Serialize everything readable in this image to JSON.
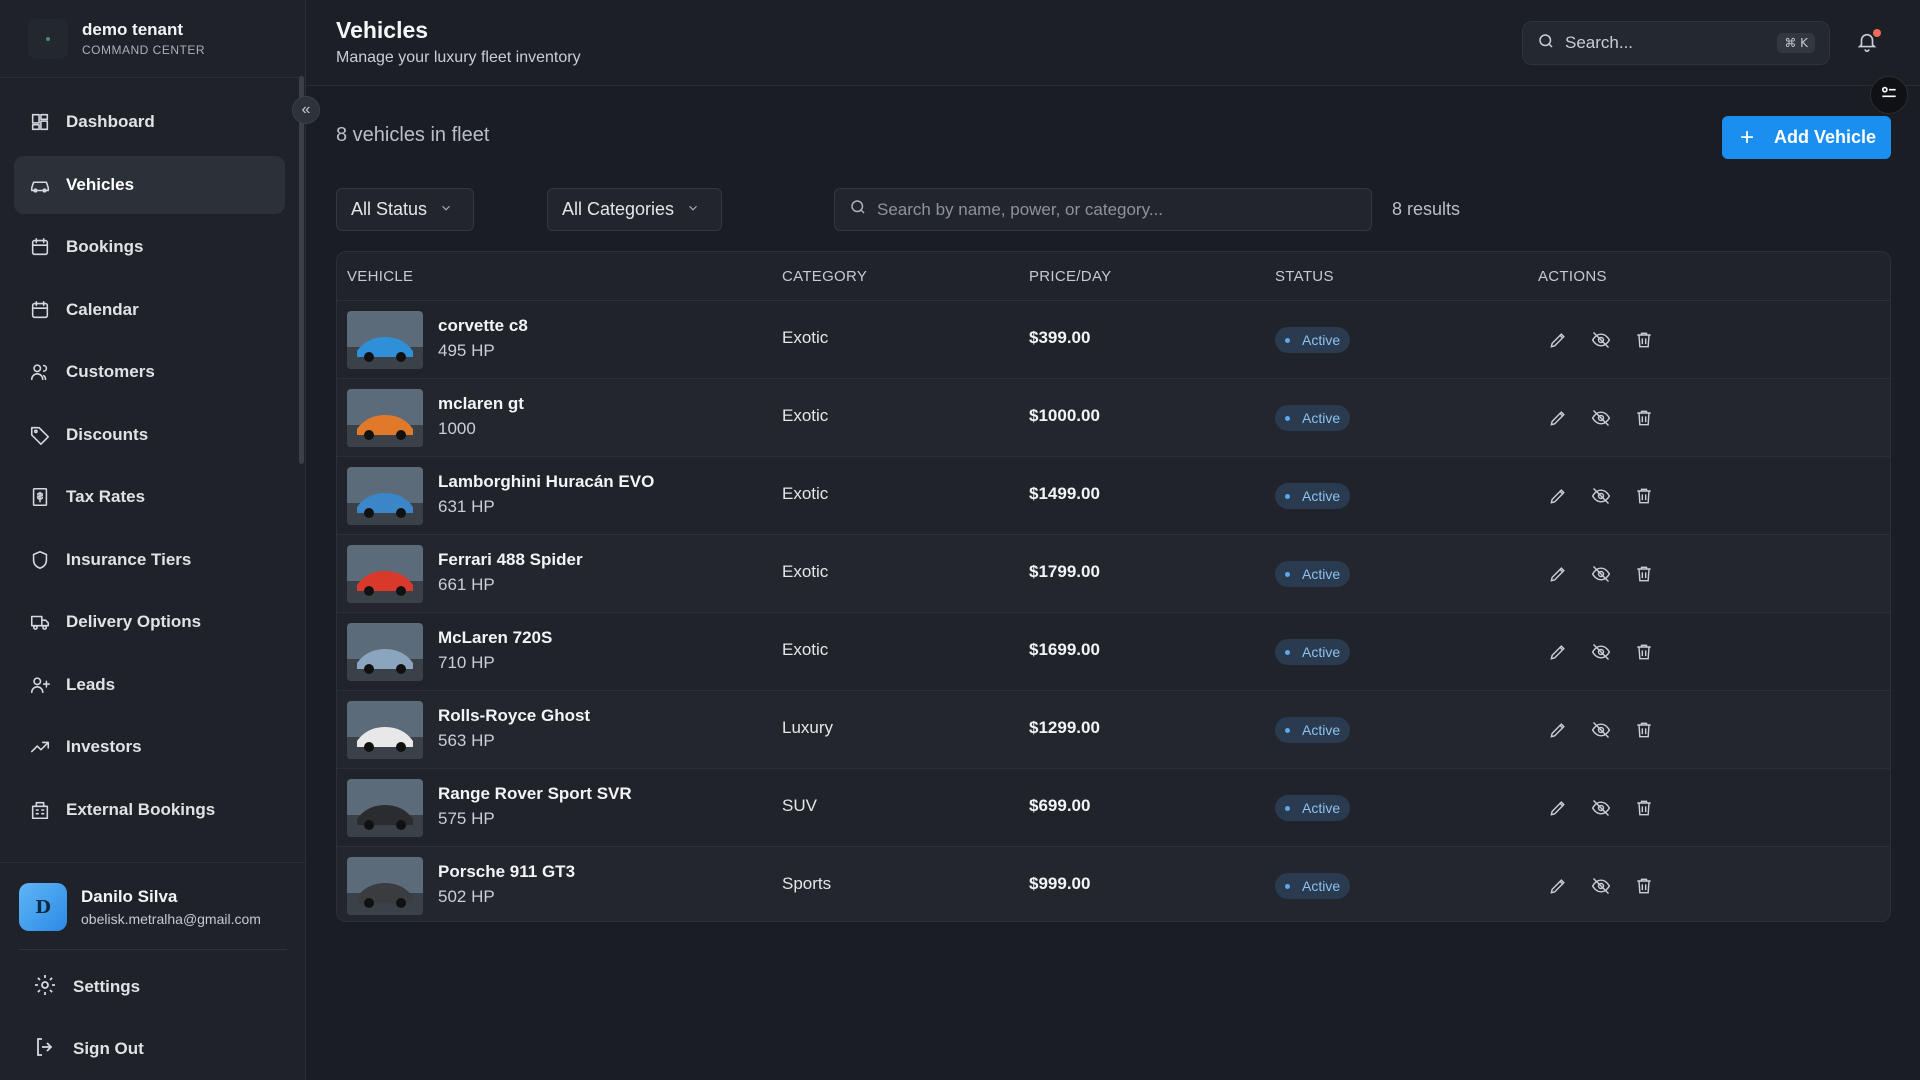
{
  "brand": {
    "title": "demo tenant",
    "subtitle": "COMMAND CENTER"
  },
  "nav": [
    {
      "label": "Dashboard",
      "icon": "dashboard-icon"
    },
    {
      "label": "Vehicles",
      "icon": "car-icon",
      "active": true
    },
    {
      "label": "Bookings",
      "icon": "calendar-icon"
    },
    {
      "label": "Calendar",
      "icon": "calendar-icon"
    },
    {
      "label": "Customers",
      "icon": "users-icon"
    },
    {
      "label": "Discounts",
      "icon": "tag-icon"
    },
    {
      "label": "Tax Rates",
      "icon": "receipt-icon"
    },
    {
      "label": "Insurance Tiers",
      "icon": "shield-icon"
    },
    {
      "label": "Delivery Options",
      "icon": "truck-icon"
    },
    {
      "label": "Leads",
      "icon": "user-plus-icon"
    },
    {
      "label": "Investors",
      "icon": "trending-up-icon"
    },
    {
      "label": "External Bookings",
      "icon": "building-icon"
    }
  ],
  "user": {
    "initial": "D",
    "name": "Danilo Silva",
    "email": "obelisk.metralha@gmail.com"
  },
  "bottom": {
    "settings": "Settings",
    "signout": "Sign Out"
  },
  "header": {
    "title": "Vehicles",
    "subtitle": "Manage your luxury fleet inventory",
    "search_placeholder": "Search...",
    "shortcut": "⌘ K"
  },
  "main": {
    "fleet_count": "8 vehicles in fleet",
    "add_label": "Add Vehicle",
    "filter_status": "All Status",
    "filter_category": "All Categories",
    "search_placeholder": "Search by name, power, or category...",
    "results": "8 results"
  },
  "table": {
    "columns": [
      "VEHICLE",
      "CATEGORY",
      "PRICE/DAY",
      "STATUS",
      "ACTIONS"
    ],
    "rows": [
      {
        "name": "corvette c8",
        "power": "495 HP",
        "category": "Exotic",
        "price": "$399.00",
        "status": "Active",
        "color": "#2f8fd8"
      },
      {
        "name": "mclaren gt",
        "power": "1000",
        "category": "Exotic",
        "price": "$1000.00",
        "status": "Active",
        "color": "#e07a2a"
      },
      {
        "name": "Lamborghini Huracán EVO",
        "power": "631 HP",
        "category": "Exotic",
        "price": "$1499.00",
        "status": "Active",
        "color": "#3a86c8"
      },
      {
        "name": "Ferrari 488 Spider",
        "power": "661 HP",
        "category": "Exotic",
        "price": "$1799.00",
        "status": "Active",
        "color": "#d8392a"
      },
      {
        "name": "McLaren 720S",
        "power": "710 HP",
        "category": "Exotic",
        "price": "$1699.00",
        "status": "Active",
        "color": "#8aa5bd"
      },
      {
        "name": "Rolls-Royce Ghost",
        "power": "563 HP",
        "category": "Luxury",
        "price": "$1299.00",
        "status": "Active",
        "color": "#e8e8e8"
      },
      {
        "name": "Range Rover Sport SVR",
        "power": "575 HP",
        "category": "SUV",
        "price": "$699.00",
        "status": "Active",
        "color": "#2a2c30"
      },
      {
        "name": "Porsche 911 GT3",
        "power": "502 HP",
        "category": "Sports",
        "price": "$999.00",
        "status": "Active",
        "color": "#3a3c40"
      }
    ]
  },
  "colors": {
    "accent": "#1a8fef",
    "status_bg": "#2a3a4f",
    "status_text": "#8cc1f0"
  }
}
